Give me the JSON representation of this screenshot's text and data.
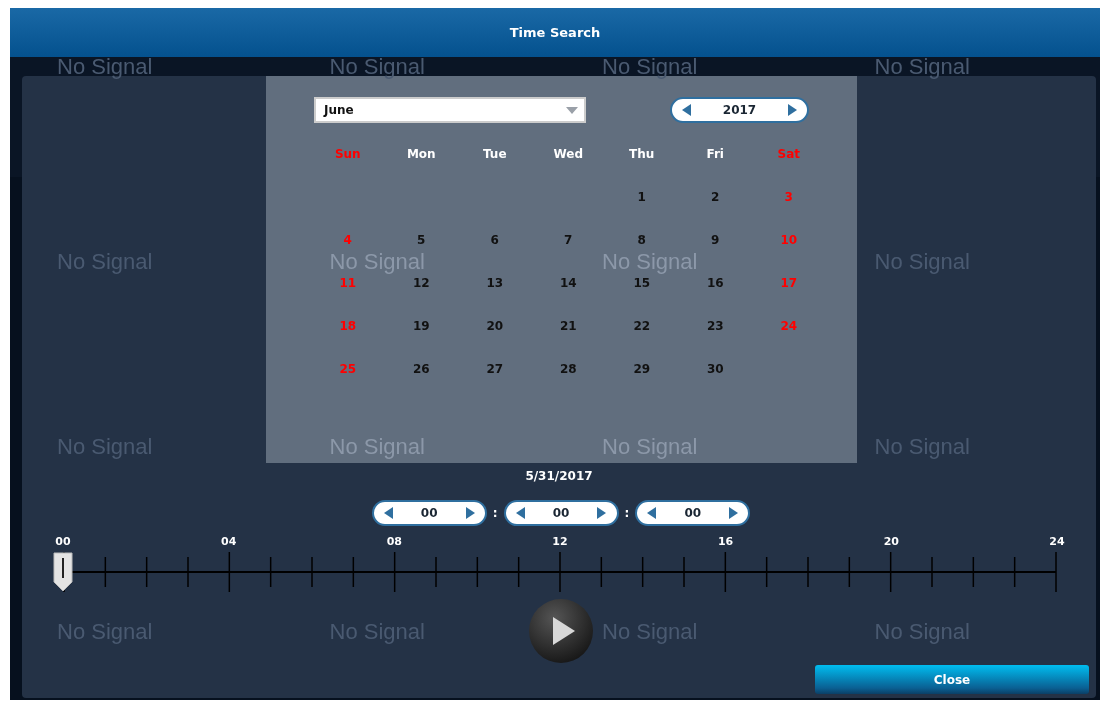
{
  "window": {
    "title": "Time Search"
  },
  "camera_tiles": [
    {
      "label": "No Signal"
    },
    {
      "label": "No Signal"
    },
    {
      "label": "No Signal"
    },
    {
      "label": "No Signal"
    },
    {
      "label": "No Signal"
    },
    {
      "label": "No Signal"
    },
    {
      "label": "No Signal"
    },
    {
      "label": "No Signal"
    },
    {
      "label": "No Signal"
    },
    {
      "label": "No Signal"
    },
    {
      "label": "No Signal"
    },
    {
      "label": "No Signal"
    },
    {
      "label": "No Signal"
    },
    {
      "label": "No Signal"
    },
    {
      "label": "No Signal"
    },
    {
      "label": "No Signal"
    }
  ],
  "calendar": {
    "month": "June",
    "year": "2017",
    "weekdays": [
      {
        "label": "Sun",
        "weekend": true
      },
      {
        "label": "Mon",
        "weekend": false
      },
      {
        "label": "Tue",
        "weekend": false
      },
      {
        "label": "Wed",
        "weekend": false
      },
      {
        "label": "Thu",
        "weekend": false
      },
      {
        "label": "Fri",
        "weekend": false
      },
      {
        "label": "Sat",
        "weekend": true
      }
    ],
    "weeks": [
      [
        {
          "kind": "blank"
        },
        {
          "kind": "blank"
        },
        {
          "kind": "blank"
        },
        {
          "kind": "blank"
        },
        {
          "kind": "day",
          "label": "1"
        },
        {
          "kind": "day",
          "label": "2"
        },
        {
          "kind": "day",
          "label": "3"
        }
      ],
      [
        {
          "kind": "day",
          "label": "4"
        },
        {
          "kind": "day",
          "label": "5"
        },
        {
          "kind": "day",
          "label": "6"
        },
        {
          "kind": "day",
          "label": "7"
        },
        {
          "kind": "day",
          "label": "8"
        },
        {
          "kind": "day",
          "label": "9"
        },
        {
          "kind": "day",
          "label": "10"
        }
      ],
      [
        {
          "kind": "day",
          "label": "11"
        },
        {
          "kind": "day",
          "label": "12"
        },
        {
          "kind": "day",
          "label": "13"
        },
        {
          "kind": "day",
          "label": "14"
        },
        {
          "kind": "day",
          "label": "15"
        },
        {
          "kind": "day",
          "label": "16"
        },
        {
          "kind": "day",
          "label": "17"
        }
      ],
      [
        {
          "kind": "day",
          "label": "18"
        },
        {
          "kind": "day",
          "label": "19"
        },
        {
          "kind": "day",
          "label": "20"
        },
        {
          "kind": "day",
          "label": "21"
        },
        {
          "kind": "day",
          "label": "22"
        },
        {
          "kind": "day",
          "label": "23"
        },
        {
          "kind": "day",
          "label": "24"
        }
      ],
      [
        {
          "kind": "day",
          "label": "25"
        },
        {
          "kind": "day",
          "label": "26"
        },
        {
          "kind": "day",
          "label": "27"
        },
        {
          "kind": "day",
          "label": "28"
        },
        {
          "kind": "day",
          "label": "29"
        },
        {
          "kind": "day",
          "label": "30"
        },
        {
          "kind": "blank"
        }
      ]
    ]
  },
  "selected_date": "5/31/2017",
  "time": {
    "fields": [
      "00",
      "00",
      "00"
    ],
    "separators": [
      ":",
      ":"
    ]
  },
  "timeline": {
    "labels": [
      "00",
      "04",
      "08",
      "12",
      "16",
      "20",
      "24"
    ],
    "level": 0
  },
  "buttons": {
    "close": "Close"
  }
}
